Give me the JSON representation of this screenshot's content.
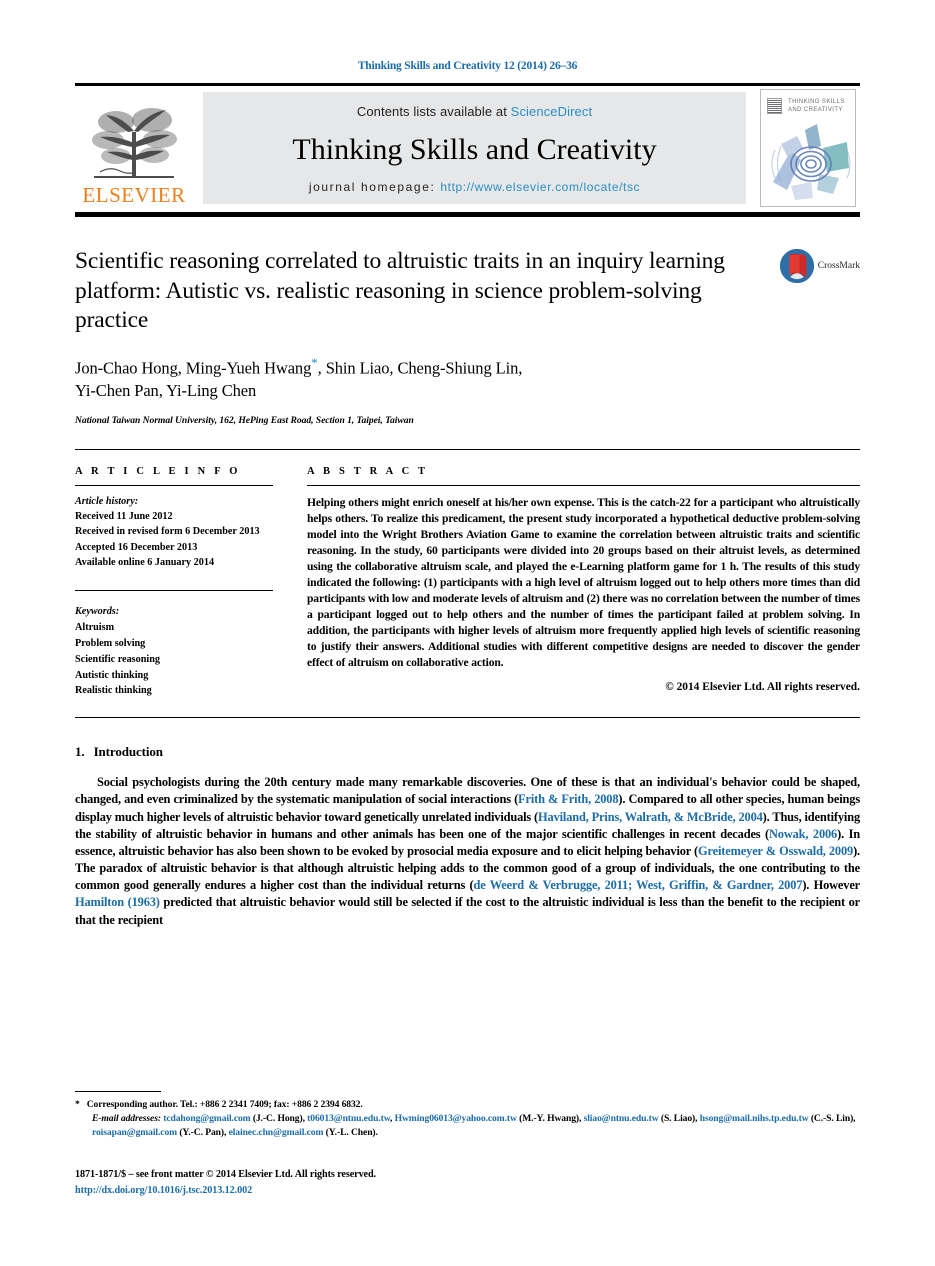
{
  "running_head": "Thinking Skills and Creativity 12 (2014) 26–36",
  "masthead": {
    "publisher_word": "ELSEVIER",
    "contents_prefix": "Contents lists available at",
    "contents_link": "ScienceDirect",
    "journal_title": "Thinking Skills and Creativity",
    "homepage_label": "journal homepage:",
    "homepage_url": "http://www.elsevier.com/locate/tsc",
    "cover_title_line1": "THINKING SKILLS",
    "cover_title_line2": "AND CREATIVITY"
  },
  "article": {
    "title": "Scientific reasoning correlated to altruistic traits in an inquiry learning platform: Autistic vs. realistic reasoning in science problem-solving practice",
    "authors": "Jon-Chao Hong, Ming-Yueh Hwang",
    "authors_rest": ", Shin Liao, Cheng-Shiung Lin,",
    "authors_line2": "Yi-Chen Pan, Yi-Ling Chen",
    "corresponding_marker": "*",
    "affiliation": "National Taiwan Normal University, 162, HePing East Road, Section 1, Taipei, Taiwan",
    "crossmark_label": "CrossMark"
  },
  "article_info": {
    "heading": "A R T I C L E    I N F O",
    "history_label": "Article history:",
    "history": [
      "Received 11 June 2012",
      "Received in revised form 6 December 2013",
      "Accepted 16 December 2013",
      "Available online 6 January 2014"
    ],
    "keywords_label": "Keywords:",
    "keywords": [
      "Altruism",
      "Problem solving",
      "Scientific reasoning",
      "Autistic thinking",
      "Realistic thinking"
    ]
  },
  "abstract": {
    "heading": "A B S T R A C T",
    "text": "Helping others might enrich oneself at his/her own expense. This is the catch-22 for a participant who altruistically helps others. To realize this predicament, the present study incorporated a hypothetical deductive problem-solving model into the Wright Brothers Aviation Game to examine the correlation between altruistic traits and scientific reasoning. In the study, 60 participants were divided into 20 groups based on their altruist levels, as determined using the collaborative altruism scale, and played the e-Learning platform game for 1 h. The results of this study indicated the following: (1) participants with a high level of altruism logged out to help others more times than did participants with low and moderate levels of altruism and (2) there was no correlation between the number of times a participant logged out to help others and the number of times the participant failed at problem solving. In addition, the participants with higher levels of altruism more frequently applied high levels of scientific reasoning to justify their answers. Additional studies with different competitive designs are needed to discover the gender effect of altruism on collaborative action.",
    "copyright": "© 2014 Elsevier Ltd. All rights reserved."
  },
  "introduction": {
    "number": "1.",
    "title": "Introduction",
    "paragraph_parts": [
      {
        "t": "Social psychologists during the 20th century made many remarkable discoveries. One of these is that an individual's behavior could be shaped, changed, and even criminalized by the systematic manipulation of social interactions (",
        "link": false
      },
      {
        "t": "Frith & Frith, 2008",
        "link": true
      },
      {
        "t": "). Compared to all other species, human beings display much higher levels of altruistic behavior toward genetically unrelated individuals (",
        "link": false
      },
      {
        "t": "Haviland, Prins, Walrath, & McBride, 2004",
        "link": true
      },
      {
        "t": "). Thus, identifying the stability of altruistic behavior in humans and other animals has been one of the major scientific challenges in recent decades (",
        "link": false
      },
      {
        "t": "Nowak, 2006",
        "link": true
      },
      {
        "t": "). In essence, altruistic behavior has also been shown to be evoked by prosocial media exposure and to elicit helping behavior (",
        "link": false
      },
      {
        "t": "Greitemeyer & Osswald, 2009",
        "link": true
      },
      {
        "t": "). The paradox of altruistic behavior is that although altruistic helping adds to the common good of a group of individuals, the one contributing to the common good generally endures a higher cost than the individual returns (",
        "link": false
      },
      {
        "t": "de Weerd & Verbrugge, 2011; West, Griffin, & Gardner, 2007",
        "link": true
      },
      {
        "t": "). However ",
        "link": false
      },
      {
        "t": "Hamilton (1963)",
        "link": true
      },
      {
        "t": " predicted that altruistic behavior would still be selected if the cost to the altruistic individual is less than the benefit to the recipient or that the recipient",
        "link": false
      }
    ]
  },
  "footnotes": {
    "corresponding_marker": "*",
    "corresponding": "Corresponding author. Tel.: +886 2 2341 7409; fax: +886 2 2394 6832.",
    "email_label": "E-mail addresses:",
    "emails": [
      {
        "addr": "tcdahong@gmail.com",
        "name": " (J.-C. Hong), "
      },
      {
        "addr": "t06013@ntnu.edu.tw",
        "name": ", "
      },
      {
        "addr": "Hwming06013@yahoo.com.tw",
        "name": " (M.-Y. Hwang), "
      },
      {
        "addr": "sliao@ntnu.edu.tw",
        "name": " (S. Liao), "
      },
      {
        "addr": "hsong@mail.nihs.tp.edu.tw",
        "name": " (C.-S. Lin), "
      },
      {
        "addr": "roisapan@gmail.com",
        "name": " (Y.-C. Pan), "
      },
      {
        "addr": "elainec.chn@gmail.com",
        "name": " (Y.-L. Chen)."
      }
    ],
    "issn_line": "1871-1871/$ – see front matter © 2014 Elsevier Ltd. All rights reserved.",
    "doi": "http://dx.doi.org/10.1016/j.tsc.2013.12.002"
  },
  "colors": {
    "link_blue": "#1b6ca8",
    "sd_blue": "#2b8fc4",
    "elsevier_orange": "#ef7d1a",
    "masthead_gray": "#e6e7e8"
  }
}
